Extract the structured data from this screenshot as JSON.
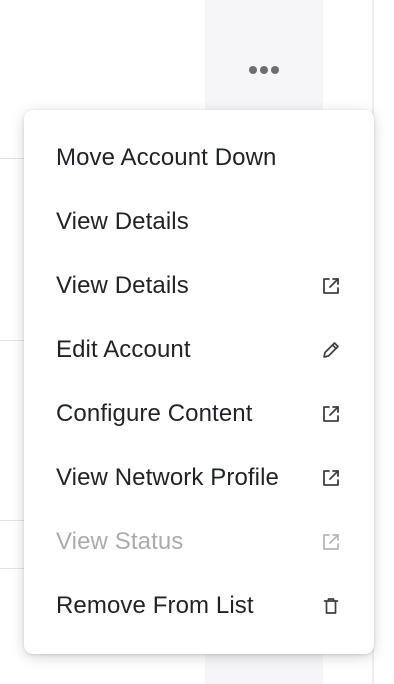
{
  "menu": {
    "items": [
      {
        "label": "Move Account Down",
        "icon": "",
        "disabled": false
      },
      {
        "label": "View Details",
        "icon": "",
        "disabled": false
      },
      {
        "label": "View Details",
        "icon": "external-link-icon",
        "disabled": false
      },
      {
        "label": "Edit Account",
        "icon": "pencil-icon",
        "disabled": false
      },
      {
        "label": "Configure Content",
        "icon": "external-link-icon",
        "disabled": false
      },
      {
        "label": "View Network Profile",
        "icon": "external-link-icon",
        "disabled": false
      },
      {
        "label": "View Status",
        "icon": "external-link-icon",
        "disabled": true
      },
      {
        "label": "Remove From List",
        "icon": "trash-icon",
        "disabled": false
      }
    ]
  },
  "colors": {
    "text": "#1f2328",
    "disabled_text": "#a8acb1",
    "icon": "#3c4046",
    "disabled_icon": "#b4b8bd",
    "more_dots": "#6b6f75"
  }
}
